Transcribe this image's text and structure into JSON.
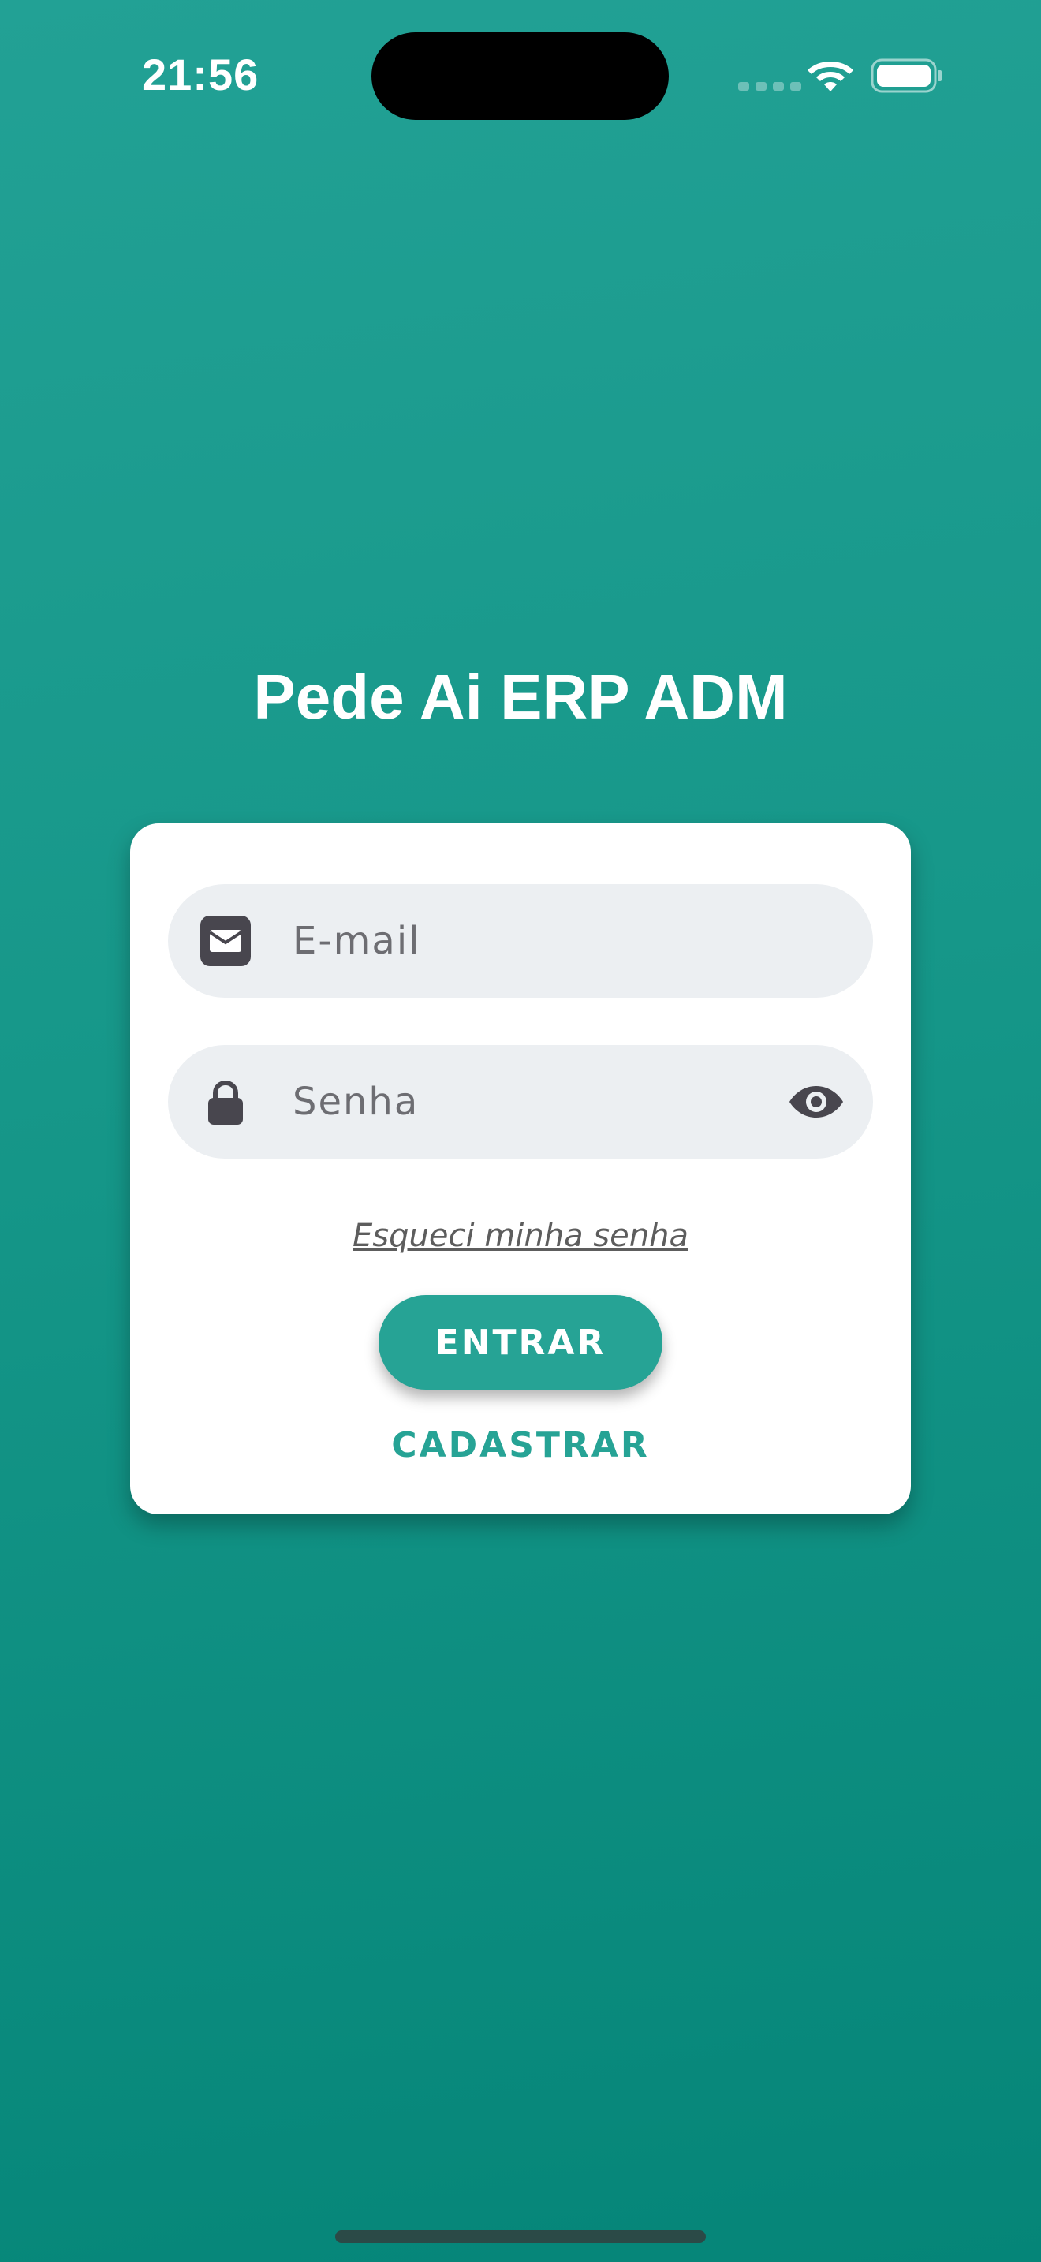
{
  "status_bar": {
    "time": "21:56",
    "wifi_icon": "wifi-icon",
    "battery_icon": "battery-icon"
  },
  "app": {
    "title": "Pede Ai ERP ADM"
  },
  "login_form": {
    "email": {
      "icon": "envelope-icon",
      "placeholder": "E-mail",
      "value": ""
    },
    "password": {
      "icon": "lock-icon",
      "placeholder": "Senha",
      "value": "",
      "toggle_icon": "eye-icon"
    },
    "forgot_password_label": "Esqueci minha senha",
    "login_label": "ENTRAR",
    "register_label": "CADASTRAR"
  },
  "colors": {
    "accent": "#26a395",
    "background_top": "#22a195",
    "background_bottom": "#058578",
    "field_background": "#eceff2",
    "icon_color": "#48464e"
  }
}
